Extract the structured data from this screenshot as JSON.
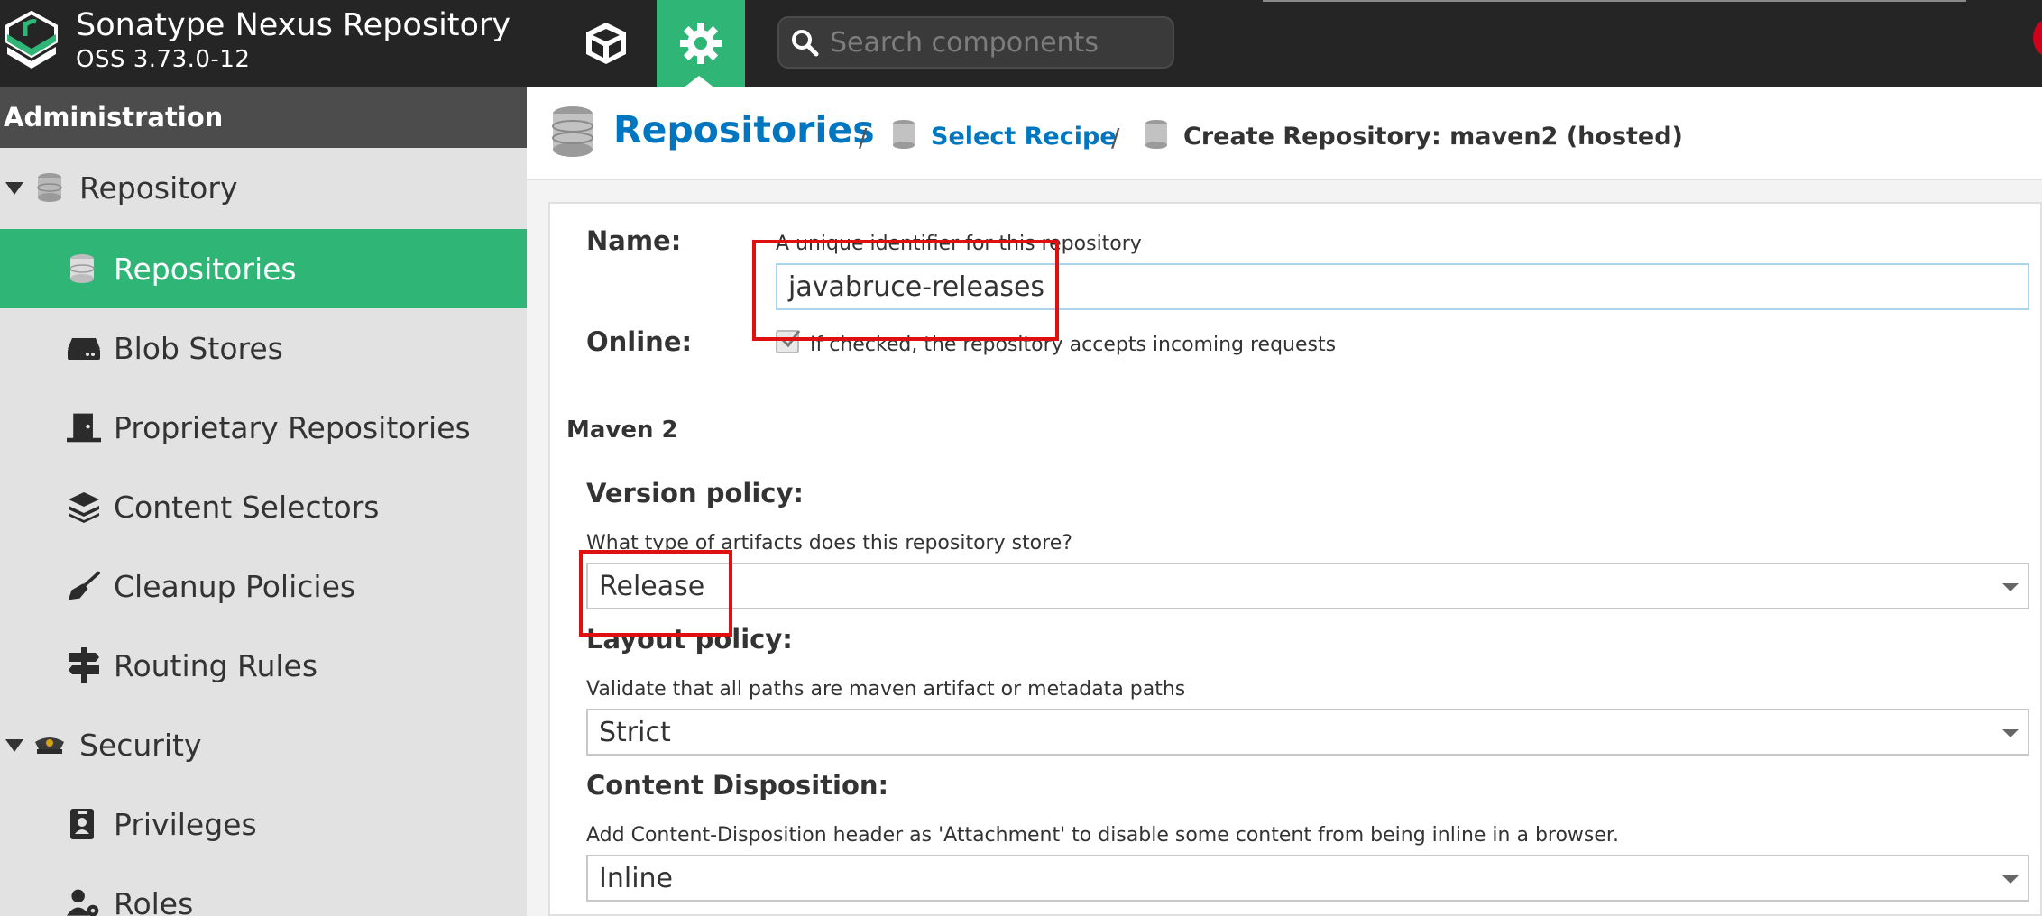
{
  "header": {
    "brand_title": "Sonatype Nexus Repository",
    "brand_version": "OSS 3.73.0-12",
    "nav_browse_icon": "cube-icon",
    "nav_admin_icon": "gear-icon",
    "search_placeholder": "Search components",
    "accent_color": "#2fb576",
    "bar_color": "#252525"
  },
  "sidebar": {
    "header": "Administration",
    "items": [
      {
        "label": "Repository",
        "icon": "database-icon",
        "expanded": true
      },
      {
        "label": "Repositories",
        "icon": "database-icon",
        "active": true
      },
      {
        "label": "Blob Stores",
        "icon": "hard-drive-icon"
      },
      {
        "label": "Proprietary Repositories",
        "icon": "door-icon"
      },
      {
        "label": "Content Selectors",
        "icon": "layers-icon"
      },
      {
        "label": "Cleanup Policies",
        "icon": "broom-icon"
      },
      {
        "label": "Routing Rules",
        "icon": "signpost-icon"
      },
      {
        "label": "Security",
        "icon": "police-hat-icon",
        "expanded": true
      },
      {
        "label": "Privileges",
        "icon": "id-badge-icon"
      },
      {
        "label": "Roles",
        "icon": "user-gear-icon"
      }
    ]
  },
  "breadcrumb": {
    "title": "Repositories",
    "separator": "/",
    "link": "Select Recipe",
    "current": "Create Repository: maven2 (hosted)"
  },
  "form": {
    "name_label": "Name:",
    "name_help": "A unique identifier for this repository",
    "name_value": "javabruce-releases",
    "online_label": "Online:",
    "online_help": "If checked, the repository accepts incoming requests",
    "online_checked": true,
    "section_title": "Maven 2",
    "version_policy_label": "Version policy:",
    "version_policy_help": "What type of artifacts does this repository store?",
    "version_policy_value": "Release",
    "layout_policy_label": "Layout policy:",
    "layout_policy_help": "Validate that all paths are maven artifact or metadata paths",
    "layout_policy_value": "Strict",
    "content_disposition_label": "Content Disposition:",
    "content_disposition_help": "Add Content-Disposition header as 'Attachment' to disable some content from being inline in a browser.",
    "content_disposition_value": "Inline"
  },
  "annotations": {
    "highlight_color": "#e01010"
  }
}
